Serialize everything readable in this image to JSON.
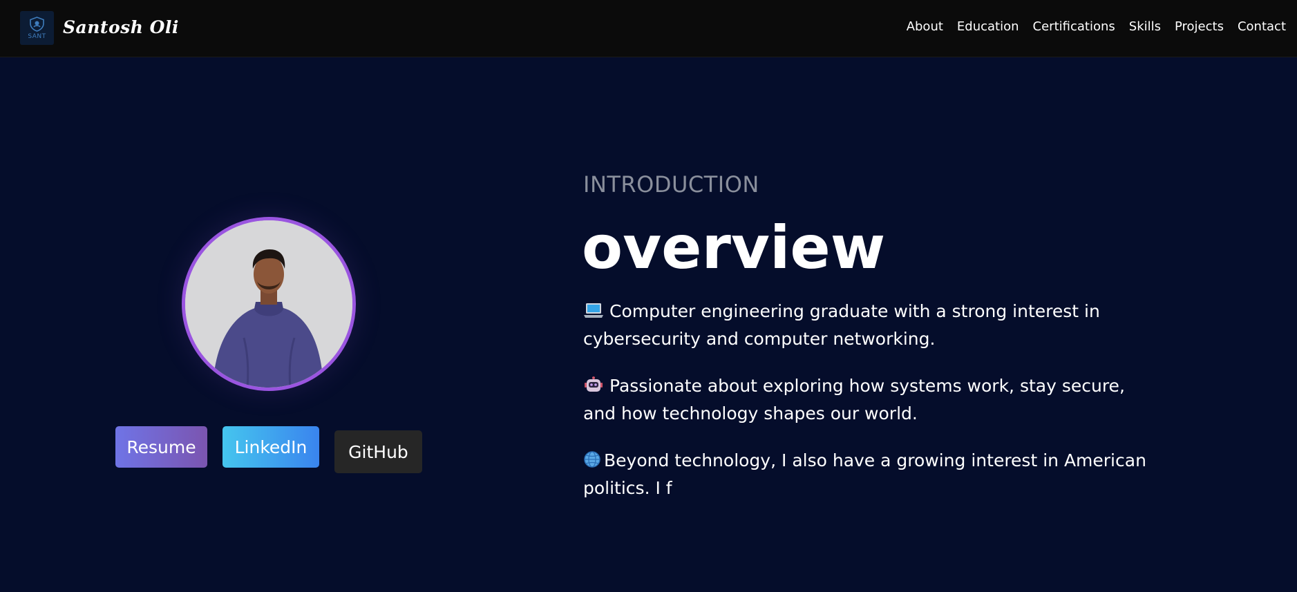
{
  "navbar": {
    "logo_text": "SANT",
    "brand": "Santosh Oli",
    "links": [
      "About",
      "Education",
      "Certifications",
      "Skills",
      "Projects",
      "Contact"
    ]
  },
  "hero": {
    "buttons": {
      "resume": "Resume",
      "linkedin": "LinkedIn",
      "github": "GitHub"
    },
    "section_label": "INTRODUCTION",
    "section_title": "overview",
    "paragraphs": [
      {
        "icon": "laptop-icon",
        "text": "Computer engineering graduate with a strong interest in cybersecurity and computer networking."
      },
      {
        "icon": "robot-icon",
        "text": "Passionate about exploring how systems work, stay secure, and how technology shapes our world."
      },
      {
        "icon": "globe-icon",
        "text": "Beyond technology, I also have a growing interest in American politics. I f"
      }
    ]
  },
  "colors": {
    "background": "#050d2b",
    "navbar": "#0b0b0b",
    "avatar_border": "#9a55e0",
    "label": "#8a8f9c"
  }
}
